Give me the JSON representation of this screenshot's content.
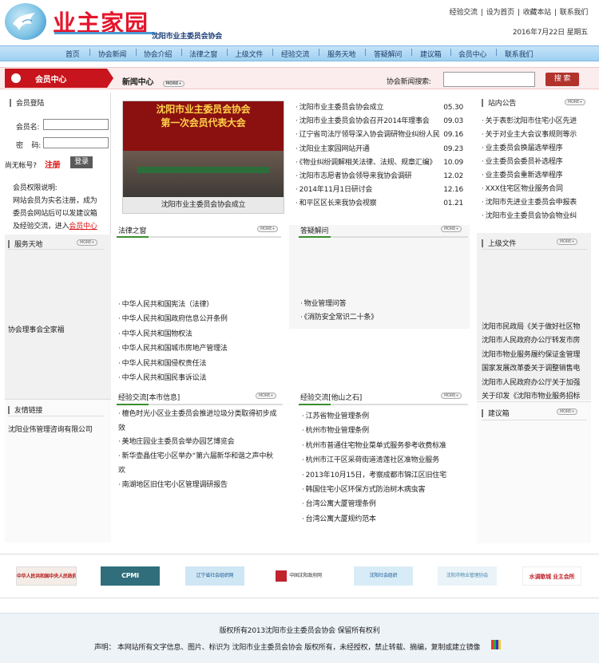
{
  "header": {
    "logo_text": "业主家园",
    "subtitle": "沈阳市业主委员会协会",
    "top_links": [
      "经验交流",
      "设为首页",
      "收藏本站",
      "联系我们"
    ],
    "date": "2016年7月22日  星期五"
  },
  "nav": [
    "首页",
    "协会新闻",
    "协会介绍",
    "法律之窗",
    "上级文件",
    "经验交流",
    "服务天地",
    "答疑解问",
    "建议箱",
    "会员中心",
    "联系我们"
  ],
  "bar": {
    "member_center": "会员中心",
    "news_center": "新闻中心",
    "more": "MORE+",
    "search_label": "协会新闻搜索:",
    "search_button": "搜 索"
  },
  "login": {
    "title": "会员登陆",
    "username_label": "会员名:",
    "password_label": "密    码:",
    "no_account": "尚无帐号?",
    "register": "注册",
    "login_button": "登录",
    "perm_title": "会员权限说明:",
    "perm_lines": [
      "网站会员为实名注册，成为",
      "委员会网站后可以发建议箱",
      "及经验交流，进入"
    ],
    "perm_link": "会员中心"
  },
  "service": {
    "title": "服务天地",
    "item": "协会理事会全家福"
  },
  "friends": {
    "title": "友情链接",
    "item": "沈阳业伟管理咨询有限公司"
  },
  "news": {
    "photo_title_line1": "沈阳市业主委员会协会",
    "photo_title_line2": "第一次会员代表大会",
    "photo_caption": "沈阳市业主委员会协会成立",
    "items": [
      {
        "title": "沈阳市业主委员会协会成立",
        "date": "05.30"
      },
      {
        "title": "沈阳市业主委员会协会召开2014年理事会",
        "date": "09.03"
      },
      {
        "title": "辽宁省司法厅领导深入协会调研物业纠纷人民",
        "date": "09.16"
      },
      {
        "title": "沈阳业主家园网站开通",
        "date": "09.23"
      },
      {
        "title": "《物业纠纷调解相关法律、法规、规章汇编》",
        "date": "10.09"
      },
      {
        "title": "沈阳市志愿者协会领导来我协会调研",
        "date": "12.02"
      },
      {
        "title": "2014年11月1日研讨会",
        "date": "12.16"
      },
      {
        "title": "和平区区长来我协会视察",
        "date": "01.21"
      }
    ]
  },
  "notice": {
    "title": "站内公告",
    "items": [
      "关于表彰沈阳市住宅小区先进",
      "关于对业主大会议事规则等示",
      "业主委员会换届选举程序",
      "业主委员会委员补选程序",
      "业主委员会重新选举程序",
      "XXX住宅区物业服务合同",
      "沈阳市先进业主委员会申报表",
      "沈阳市业主委员会协会物业纠"
    ]
  },
  "law": {
    "title": "法律之窗",
    "items": [
      "中华人民共和国宪法（法律）",
      "中华人民共和国政府信息公开条例",
      "中华人民共和国物权法",
      "中华人民共和国城市房地产管理法",
      "中华人民共和国侵权责任法",
      "中华人民共和国民事诉讼法"
    ]
  },
  "qa": {
    "title": "答疑解问",
    "items": [
      "物业管理问答",
      "《消防安全常识二十条》"
    ]
  },
  "upper": {
    "title": "上级文件",
    "items": [
      "沈阳市民政局《关于做好社区物",
      "沈阳市人民政府办公厅转发市房",
      "沈阳市物业服务履约保证金管理",
      "国家发展改革委关于调整销售电",
      "沈阳市人民政府办公厅关于加强",
      "关于印发《沈阳市物业服务招标"
    ]
  },
  "exchange_local": {
    "title": "经验交流[本市信息]",
    "items": [
      "檀色时光小区业主委员会推进垃圾分类取得初步成",
      "效",
      "美地庄园业主委员会举办园艺博览会",
      "新华壶晶住宅小区举办“第六届新华和谐之声中秋",
      "欢",
      "南湖地区旧住宅小区管理调研报告"
    ]
  },
  "exchange_other": {
    "title": "经验交流[他山之石]",
    "items": [
      "江苏省物业管理条例",
      "杭州市物业管理条例",
      "杭州市普通住宅物业菜单式服务参考收费标准",
      "杭州市江干区采荷街道清莲社区准物业服务",
      "2013年10月15日，考察成都市锦江区旧住宅",
      "韩国住宅小区环保方式防治树木病虫害",
      "台湾公寓大厦管理条例",
      "台湾公寓大厦规约范本"
    ]
  },
  "suggest": {
    "title": "建议箱"
  },
  "partners": [
    "中华人民共和国中央人民政府",
    "CPMI",
    "辽宁省社会组织网",
    "中国沈阳政府网",
    "沈阳社会组织",
    "沈阳市物业管理协会",
    "水调歌城 业主会所"
  ],
  "footer": {
    "copyright": "版权所有2013沈阳市业主委员会协会 保留所有权利",
    "notice": "声明： 本网站所有文字信息、图片、标识为 沈阳市业主委员会协会 版权所有，未经授权，禁止转载、摘编，复制或建立镜像"
  }
}
